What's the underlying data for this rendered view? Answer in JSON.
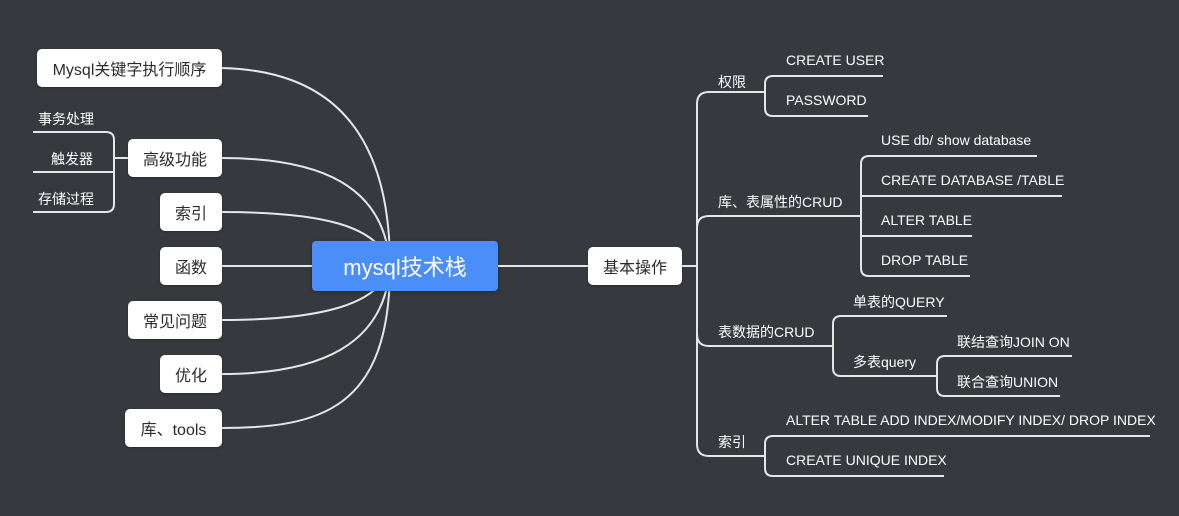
{
  "root": {
    "label": "mysql技术栈"
  },
  "left_branches": {
    "keyword_order": "Mysql关键字执行顺序",
    "advanced": {
      "label": "高级功能",
      "children": [
        "事务处理",
        "触发器",
        "存储过程"
      ]
    },
    "index": "索引",
    "functions": "函数",
    "faq": "常见问题",
    "optimize": "优化",
    "tools": "库、tools"
  },
  "right_branch": {
    "label": "基本操作",
    "privilege": {
      "label": "权限",
      "children": [
        "CREATE USER",
        "PASSWORD"
      ]
    },
    "db_crud": {
      "label": "库、表属性的CRUD",
      "children": [
        "USE db/ show database",
        "CREATE DATABASE /TABLE",
        "ALTER TABLE",
        "DROP TABLE"
      ]
    },
    "data_crud": {
      "label": "表数据的CRUD",
      "single": "单表的QUERY",
      "multi": {
        "label": "多表query",
        "children": [
          "联结查询JOIN ON",
          "联合查询UNION"
        ]
      }
    },
    "index": {
      "label": "索引",
      "children": [
        "ALTER TABLE ADD INDEX/MODIFY INDEX/ DROP INDEX",
        "CREATE UNIQUE INDEX"
      ]
    }
  },
  "colors": {
    "background": "#36393e",
    "root": "#4b8ef7",
    "line": "#e8e8e8",
    "node": "#ffffff"
  }
}
